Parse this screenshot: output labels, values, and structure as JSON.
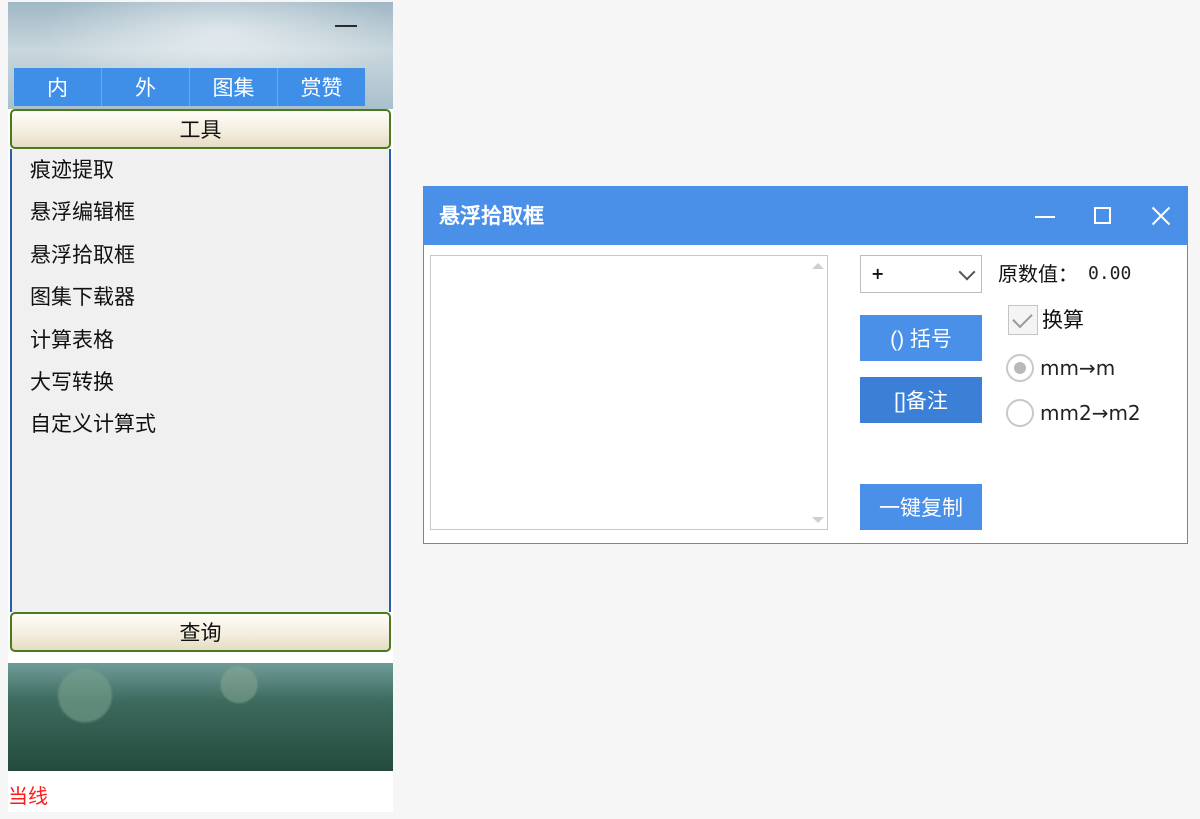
{
  "sidebar": {
    "tabs": [
      {
        "label": "内"
      },
      {
        "label": "外"
      },
      {
        "label": "图集"
      },
      {
        "label": "赏赞"
      }
    ],
    "tools_header": "工具",
    "tools": [
      {
        "label": "痕迹提取"
      },
      {
        "label": "悬浮编辑框"
      },
      {
        "label": "悬浮拾取框"
      },
      {
        "label": "图集下载器"
      },
      {
        "label": "计算表格"
      },
      {
        "label": "大写转换"
      },
      {
        "label": "自定义计算式"
      }
    ],
    "query_header": "查询",
    "status_link": "当线"
  },
  "window": {
    "title": "悬浮拾取框",
    "textarea_value": "",
    "operator": "+",
    "original_label": "原数值：",
    "original_value": "0.00",
    "buttons": {
      "parens": "() 括号",
      "note": "[]备注",
      "copy": "一键复制"
    },
    "convert_checkbox": {
      "label": "换算",
      "checked": true
    },
    "unit_options": [
      {
        "label": "mm→m",
        "selected": true
      },
      {
        "label": "mm2→m2",
        "selected": false
      }
    ]
  },
  "colors": {
    "accent": "#4a90e8",
    "tab_blue": "#3f8ee8",
    "header_border": "#4b7a1e",
    "status_red": "#ff1a1a"
  }
}
